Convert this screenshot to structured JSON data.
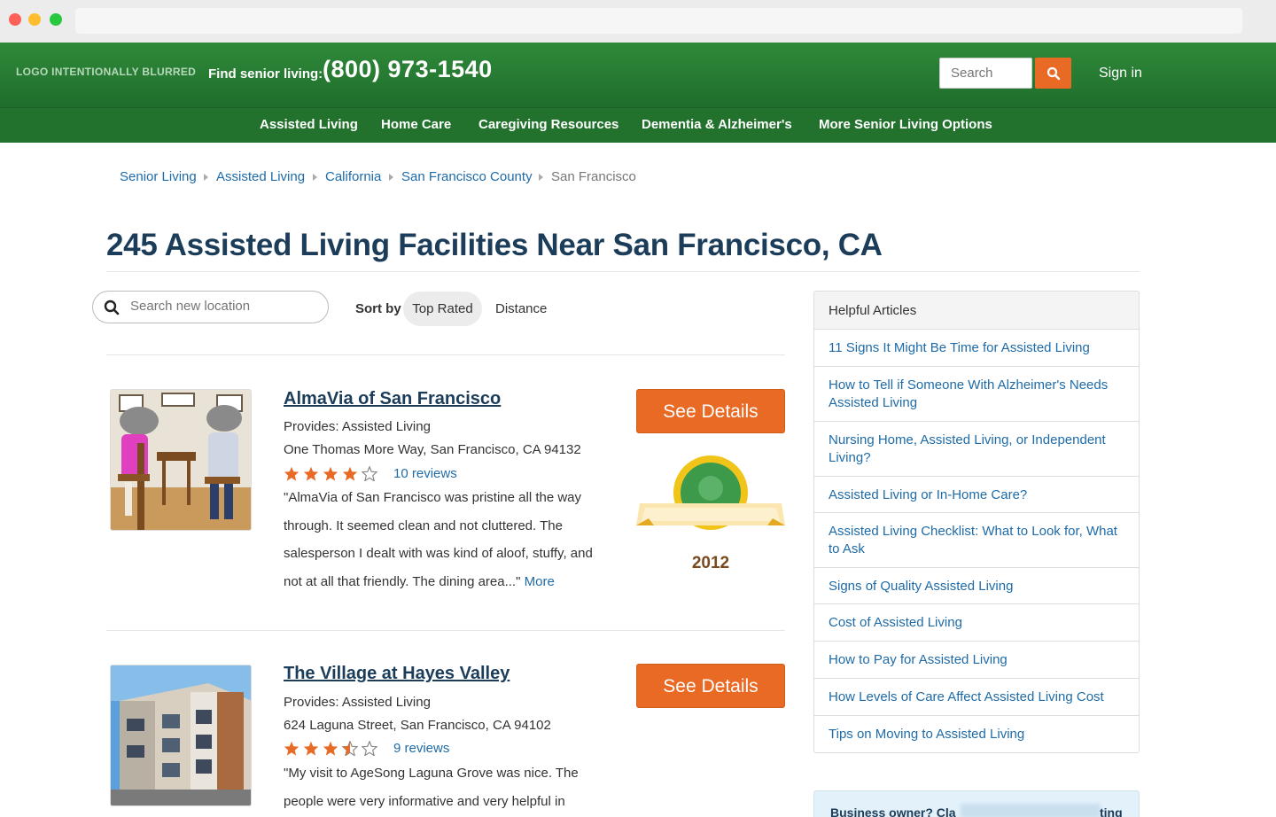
{
  "header": {
    "logo_text": "LOGO INTENTIONALLY BLURRED",
    "find_label": "Find senior living:",
    "phone": "(800) 973-1540",
    "search_placeholder": "Search",
    "signin": "Sign in"
  },
  "nav": {
    "items": [
      {
        "label": "Assisted Living"
      },
      {
        "label": "Home Care"
      },
      {
        "label": "Caregiving Resources"
      },
      {
        "label": "Dementia & Alzheimer's"
      },
      {
        "label": "More Senior Living Options"
      }
    ]
  },
  "breadcrumbs": [
    {
      "label": "Senior Living"
    },
    {
      "label": "Assisted Living"
    },
    {
      "label": "California"
    },
    {
      "label": "San Francisco County"
    },
    {
      "label": "San Francisco"
    }
  ],
  "page": {
    "title": "245 Assisted Living Facilities Near San Francisco, CA"
  },
  "filters": {
    "location_placeholder": "Search new location",
    "sort_label": "Sort by",
    "sort_options": [
      {
        "label": "Top Rated",
        "active": true
      },
      {
        "label": "Distance",
        "active": false
      }
    ]
  },
  "listings": [
    {
      "name": "AlmaVia of San Francisco",
      "provides": "Provides: Assisted Living",
      "address": "One Thomas More Way, San Francisco, CA 94132",
      "rating": 4,
      "reviews": "10 reviews",
      "quote": "\"AlmaVia of San Francisco was pristine all the way through. It seemed clean and not cluttered. The salesperson I dealt with was kind of aloof, stuffy, and not at all that friendly. The dining area...\"",
      "more": "More",
      "button": "See Details",
      "award_year": "2012"
    },
    {
      "name": "The Village at Hayes Valley",
      "provides": "Provides: Assisted Living",
      "address": "624 Laguna Street, San Francisco, CA 94102",
      "rating": 3.5,
      "reviews": "9 reviews",
      "quote": "\"My visit to AgeSong Laguna Grove was nice. The people were very informative and very helpful in",
      "button": "See Details"
    }
  ],
  "sidebar": {
    "title": "Helpful Articles",
    "articles": [
      {
        "label": "11 Signs It Might Be Time for Assisted Living"
      },
      {
        "label": "How to Tell if Someone With Alzheimer's Needs Assisted Living"
      },
      {
        "label": "Nursing Home, Assisted Living, or Independent Living?"
      },
      {
        "label": "Assisted Living or In-Home Care?"
      },
      {
        "label": "Assisted Living Checklist: What to Look for, What to Ask"
      },
      {
        "label": "Signs of Quality Assisted Living"
      },
      {
        "label": "Cost of Assisted Living"
      },
      {
        "label": "How to Pay for Assisted Living"
      },
      {
        "label": "How Levels of Care Affect Assisted Living Cost"
      },
      {
        "label": "Tips on Moving to Assisted Living"
      }
    ],
    "business_prefix": "Business owner? Cla",
    "business_suffix": "ting"
  },
  "colors": {
    "header_green": "#2f8a3a",
    "nav_green": "#22722d",
    "accent_orange": "#e86a24",
    "link_blue": "#1e6ba8",
    "heading_navy": "#1c3d5a"
  },
  "icons": {
    "search": "search-icon",
    "star_full": "star-icon",
    "star_half": "star-half-icon",
    "star_empty": "star-empty-icon",
    "breadcrumb_sep": "chevron-right-icon"
  }
}
